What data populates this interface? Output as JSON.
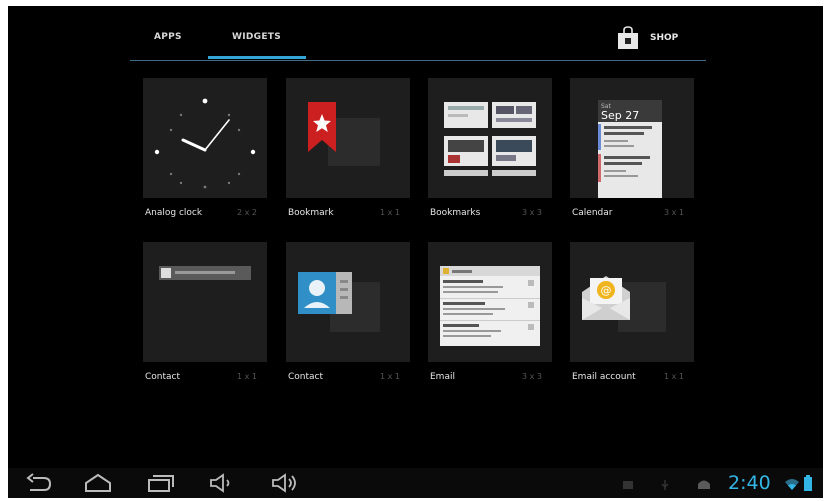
{
  "tabs": {
    "apps_label": "APPS",
    "widgets_label": "WIDGETS",
    "shop_label": "SHOP"
  },
  "widgets": [
    {
      "name": "Analog clock",
      "size": "2 x 2"
    },
    {
      "name": "Bookmark",
      "size": "1 x 1"
    },
    {
      "name": "Bookmarks",
      "size": "3 x 3"
    },
    {
      "name": "Calendar",
      "size": "3 x 1"
    },
    {
      "name": "Contact",
      "size": "1 x 1"
    },
    {
      "name": "Contact",
      "size": "1 x 1"
    },
    {
      "name": "Email",
      "size": "3 x 3"
    },
    {
      "name": "Email account",
      "size": "1 x 1"
    }
  ],
  "calendar_preview": {
    "day_label": "Sat",
    "date_label": "Sep 27"
  },
  "status": {
    "time": "2:40"
  },
  "colors": {
    "accent": "#33b5e5",
    "bookmark_red": "#cc1f1f"
  }
}
